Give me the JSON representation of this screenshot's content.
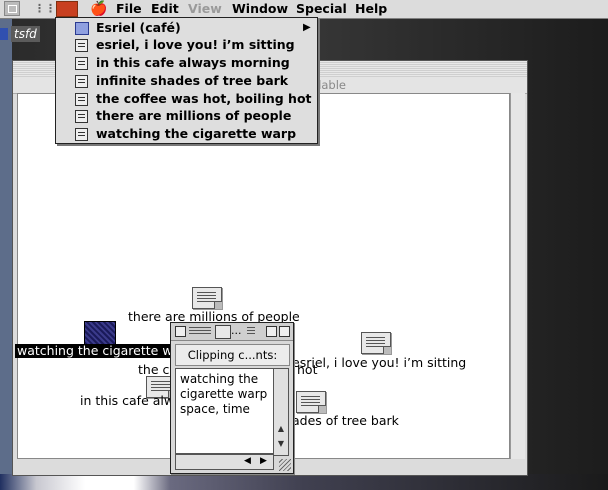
{
  "menubar": {
    "items": [
      {
        "label": "File"
      },
      {
        "label": "Edit"
      },
      {
        "label": "View"
      },
      {
        "label": "Window"
      },
      {
        "label": "Special"
      },
      {
        "label": "Help"
      }
    ],
    "apple_icon": "apple-icon"
  },
  "desktop": {
    "volume_label": "tsfd"
  },
  "menu": {
    "items": [
      {
        "label": "Esriel (café)",
        "icon": "folder-icon",
        "has_submenu": true
      },
      {
        "label": "esriel, i love you! i’m sitting",
        "icon": "clipping-icon"
      },
      {
        "label": "in this cafe always morning",
        "icon": "clipping-icon"
      },
      {
        "label": "infinite shades of tree bark",
        "icon": "clipping-icon"
      },
      {
        "label": "the coffee was hot, boiling hot",
        "icon": "clipping-icon"
      },
      {
        "label": "there are millions of people",
        "icon": "clipping-icon"
      },
      {
        "label": "watching the cigarette warp",
        "icon": "clipping-icon"
      }
    ]
  },
  "main_window": {
    "status_text": "ilable",
    "icons": [
      {
        "label": "there are millions of people",
        "selected": false
      },
      {
        "label": "watching the cigarette wa",
        "selected": true
      },
      {
        "label": "the co",
        "selected": false
      },
      {
        "label": "hot",
        "selected": false
      },
      {
        "label": "esriel, i love you! i’m sitting",
        "selected": false
      },
      {
        "label": "in this cafe alwa",
        "selected": false
      },
      {
        "label": "ades of tree bark",
        "selected": false
      }
    ]
  },
  "clipping_window": {
    "header": "Clipping c...nts: text",
    "content": "watching the\ncigarette warp\nspace, time",
    "dots": "..."
  }
}
